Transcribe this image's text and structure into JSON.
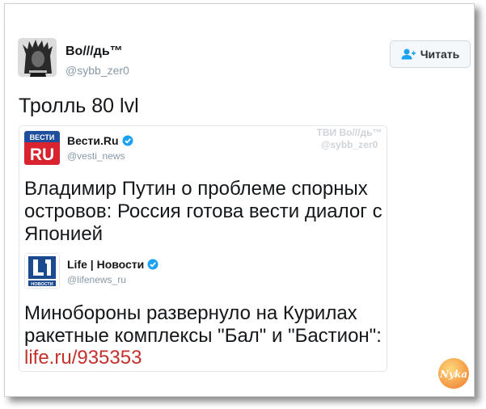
{
  "author": {
    "name": "Во///дь™",
    "handle": "@sybb_zer0",
    "avatar_icon": "avatar-indian-chief"
  },
  "follow_button": {
    "label": "Читать",
    "icon": "add-user-icon"
  },
  "tweet": {
    "text": "Тролль 80 lvl"
  },
  "watermark": {
    "line1": "ТВИ Во///дь™",
    "line2": "@sybb_zer0"
  },
  "quoted": {
    "name": "Вести.Ru",
    "handle": "@vesti_news",
    "logo_top": "ВЕСТИ",
    "logo_bottom": "RU",
    "text": "Владимир Путин о проблеме спорных островов: Россия готова вести диалог с Японией"
  },
  "nested": {
    "name": "Life | Новости",
    "handle": "@lifenews_ru",
    "logo_caption": "НОВОСТИ",
    "text": "Минобороны развернуло на Курилах ракетные комплексы \"Бал\" и \"Бастион\":",
    "link": "life.ru/935353"
  },
  "site_logo": {
    "text": "Nyka"
  },
  "colors": {
    "verified": "#1da1f2",
    "link": "#c4302b",
    "vesti_red": "#d9232e",
    "vesti_blue": "#1e4e9c",
    "life_blue": "#1b4a8e"
  }
}
